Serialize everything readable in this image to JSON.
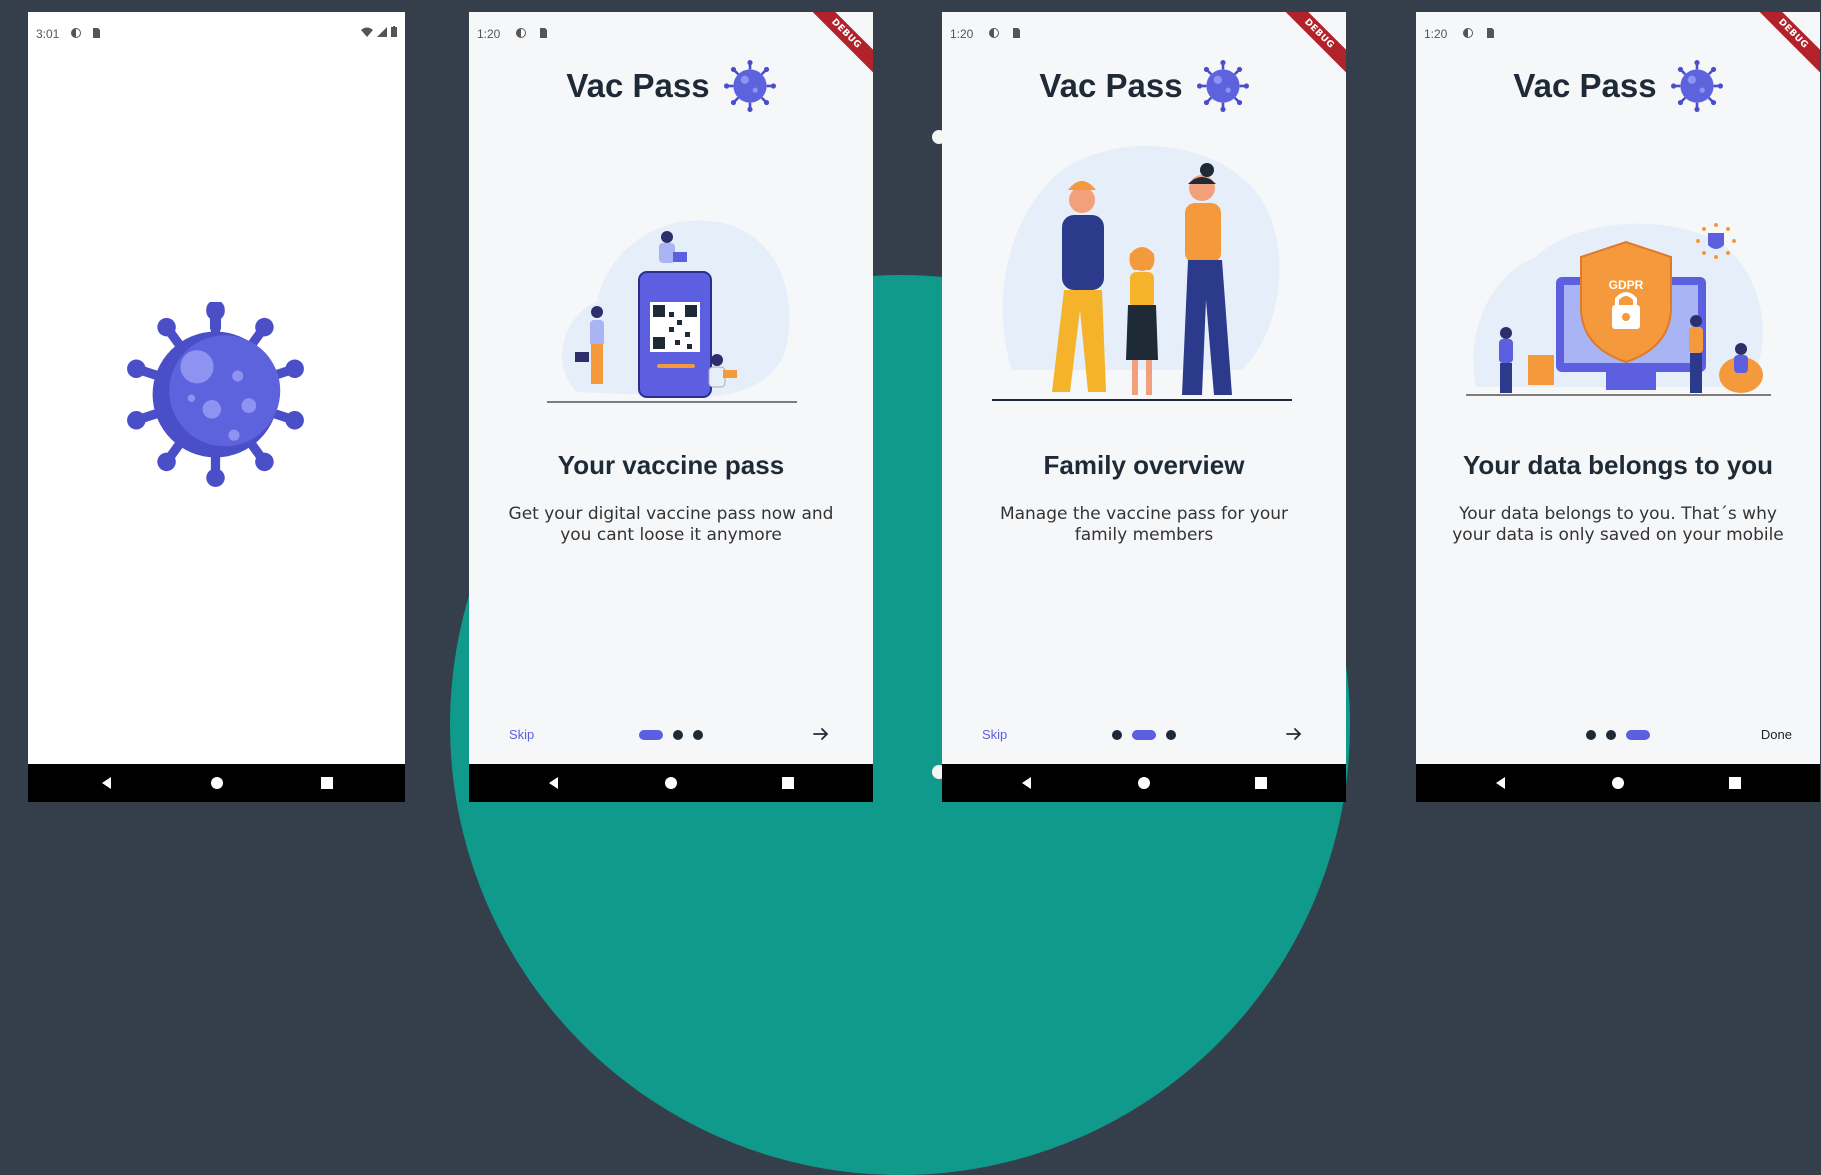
{
  "colors": {
    "background": "#353f4c",
    "teal": "#109a8c",
    "accent": "#5b5fe0",
    "dark_text": "#1f2a37",
    "debug_ribbon": "#b1222a"
  },
  "splash": {
    "status": {
      "time": "3:01"
    },
    "logo_icon": "virus-icon"
  },
  "screens": [
    {
      "status_time": "1:20",
      "brand": "Vac Pass",
      "debug_label": "DEBUG",
      "headline": "Your vaccine pass",
      "body": "Get your digital vaccine pass now and you cant loose it anymore",
      "skip_label": "Skip",
      "active_dot": 0,
      "illustration": "qr-pass-illustration"
    },
    {
      "status_time": "1:20",
      "brand": "Vac Pass",
      "debug_label": "DEBUG",
      "headline": "Family overview",
      "body": "Manage the vaccine pass for your family members",
      "skip_label": "Skip",
      "active_dot": 1,
      "illustration": "family-illustration"
    },
    {
      "status_time": "1:20",
      "brand": "Vac Pass",
      "debug_label": "DEBUG",
      "headline": "Your data belongs to you",
      "body": "Your data belongs to you. That´s why your data is only saved on your mobile",
      "done_label": "Done",
      "active_dot": 2,
      "illustration": "gdpr-illustration",
      "gdpr_text": "GDPR"
    }
  ]
}
